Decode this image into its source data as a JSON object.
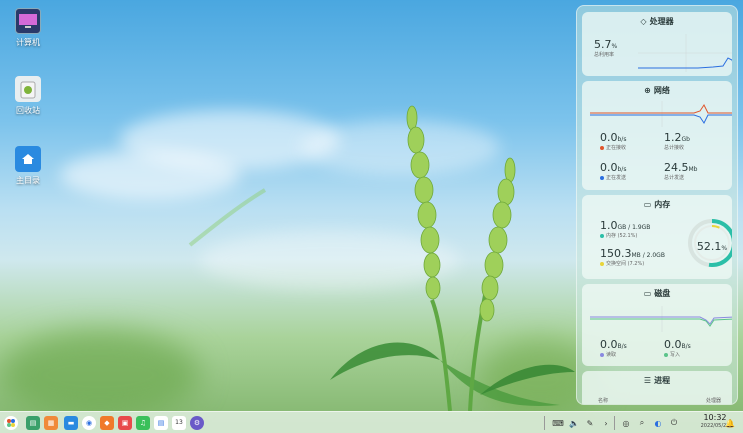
{
  "desktop": {
    "icons": [
      {
        "label": "计算机",
        "icon": "computer-icon"
      },
      {
        "label": "回收站",
        "icon": "trash-icon"
      },
      {
        "label": "主目录",
        "icon": "home-folder-icon"
      }
    ]
  },
  "panel": {
    "cpu": {
      "title": "处理器",
      "value": "5.7",
      "unit": "%",
      "label": "总利用率"
    },
    "network": {
      "title": "网络",
      "recv_value": "0.0",
      "recv_unit": "b/s",
      "recv_label": "正在接收",
      "total_recv_value": "1.2",
      "total_recv_unit": "Gb",
      "total_recv_label": "总计接收",
      "send_value": "0.0",
      "send_unit": "b/s",
      "send_label": "正在发送",
      "total_send_value": "24.5",
      "total_send_unit": "Mb",
      "total_send_label": "总计发送"
    },
    "memory": {
      "title": "内存",
      "mem_value": "1.0",
      "mem_unit": "GB / 1.9GB",
      "mem_label": "内存 (52.1%)",
      "swap_value": "150.3",
      "swap_unit": "MB / 2.0GB",
      "swap_label": "交换空间 (7.2%)",
      "ring_value": "52.1",
      "ring_unit": "%",
      "mem_percent": 52.1,
      "swap_percent": 7.2
    },
    "disk": {
      "title": "磁盘",
      "read_value": "0.0",
      "read_unit": "B/s",
      "read_label": "读取",
      "write_value": "0.0",
      "write_unit": "B/s",
      "write_label": "写入"
    },
    "process": {
      "title": "进程",
      "col_name": "名称",
      "col_cpu": "处理器"
    }
  },
  "taskbar": {
    "time": "10:32",
    "date": "2022/05/23",
    "calendar_day": "13"
  },
  "colors": {
    "recv": "#e0552b",
    "send": "#2b6fe0",
    "mem": "#2bbfa8",
    "swap": "#e8d53a",
    "read": "#8a8ae0",
    "write": "#5bc48a"
  }
}
